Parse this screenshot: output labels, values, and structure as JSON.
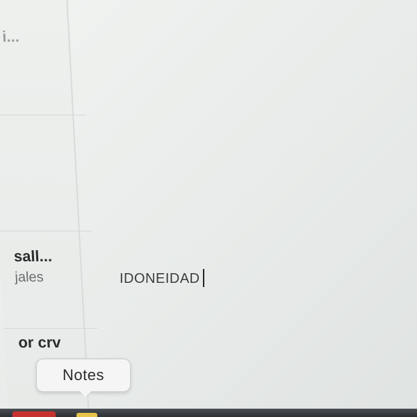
{
  "sidebar": {
    "items": [
      {
        "title": "i...",
        "subtitle": ""
      },
      {
        "title": "",
        "subtitle": ""
      },
      {
        "title": "sall...",
        "subtitle": "jales"
      },
      {
        "title": "or crv",
        "subtitle": ""
      }
    ]
  },
  "editor": {
    "text": "IDONEIDAD"
  },
  "dock": {
    "tooltip_label": "Notes",
    "icons": [
      "red-app-icon",
      "notes-app-icon"
    ]
  },
  "colors": {
    "background": "#e9ecea",
    "dock_red": "#c8322e",
    "dock_yellow": "#e7c24a"
  }
}
